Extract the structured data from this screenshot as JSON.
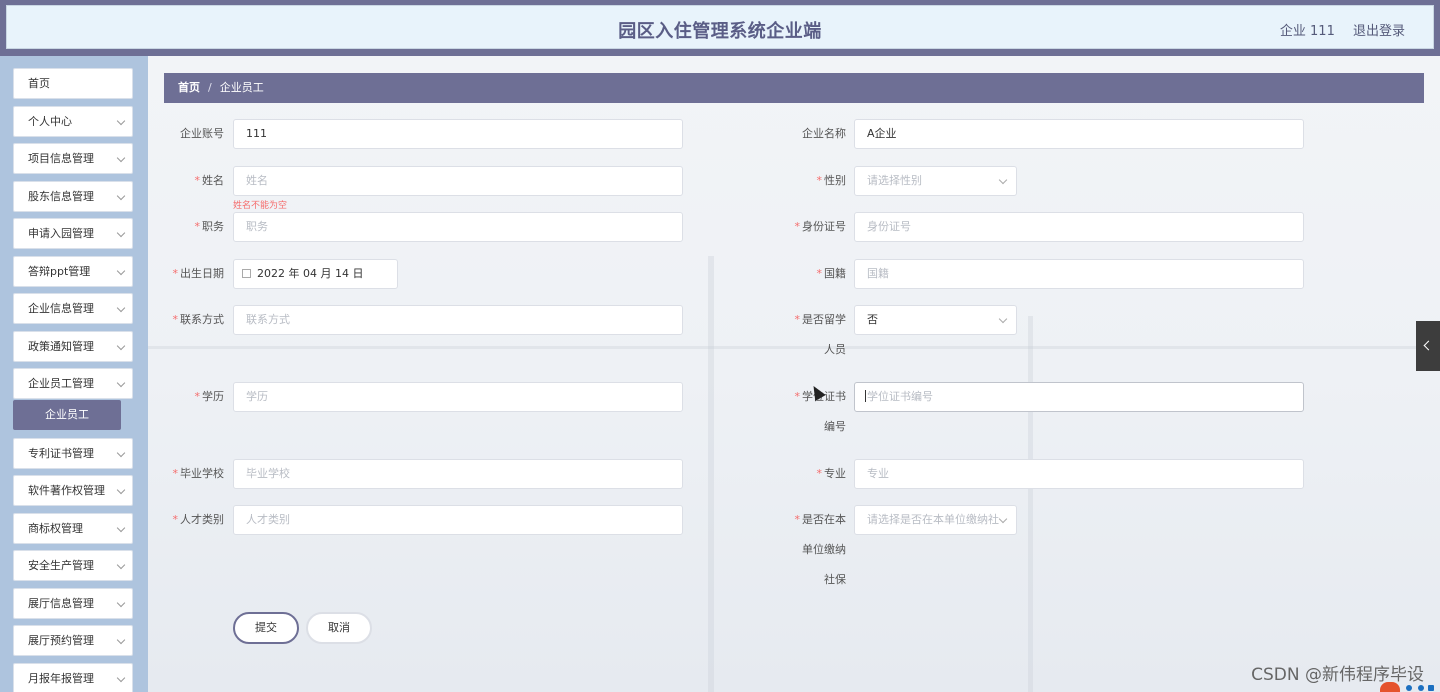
{
  "header": {
    "title": "园区入住管理系统企业端",
    "user": "企业 111",
    "logout": "退出登录"
  },
  "sidebar": {
    "items": [
      {
        "label": "首页",
        "has_arrow": false
      },
      {
        "label": "个人中心",
        "has_arrow": true
      },
      {
        "label": "项目信息管理",
        "has_arrow": true
      },
      {
        "label": "股东信息管理",
        "has_arrow": true
      },
      {
        "label": "申请入园管理",
        "has_arrow": true
      },
      {
        "label": "答辩ppt管理",
        "has_arrow": true
      },
      {
        "label": "企业信息管理",
        "has_arrow": true
      },
      {
        "label": "政策通知管理",
        "has_arrow": true
      },
      {
        "label": "企业员工管理",
        "has_arrow": true
      },
      {
        "label": "专利证书管理",
        "has_arrow": true
      },
      {
        "label": "软件著作权管理",
        "has_arrow": true
      },
      {
        "label": "商标权管理",
        "has_arrow": true
      },
      {
        "label": "安全生产管理",
        "has_arrow": true
      },
      {
        "label": "展厅信息管理",
        "has_arrow": true
      },
      {
        "label": "展厅预约管理",
        "has_arrow": true
      },
      {
        "label": "月报年报管理",
        "has_arrow": true
      }
    ],
    "active_sub": "企业员工"
  },
  "breadcrumb": {
    "home": "首页",
    "separator": "/",
    "current": "企业员工"
  },
  "form": {
    "company_account": {
      "label": "企业账号",
      "value": "111"
    },
    "company_name": {
      "label": "企业名称",
      "value": "A企业"
    },
    "name": {
      "label": "姓名",
      "placeholder": "姓名",
      "error": "姓名不能为空"
    },
    "gender": {
      "label": "性别",
      "placeholder": "请选择性别"
    },
    "position": {
      "label": "职务",
      "placeholder": "职务"
    },
    "id_number": {
      "label": "身份证号",
      "placeholder": "身份证号"
    },
    "birth_date": {
      "label": "出生日期",
      "value": "2022 年 04 月 14 日"
    },
    "nationality": {
      "label": "国籍",
      "placeholder": "国籍"
    },
    "contact": {
      "label": "联系方式",
      "placeholder": "联系方式"
    },
    "studied_abroad": {
      "label_line1": "是否留学",
      "label_line2": "人员",
      "value": "否"
    },
    "education": {
      "label": "学历",
      "placeholder": "学历"
    },
    "degree_cert": {
      "label_line1": "学位证书",
      "label_line2": "编号",
      "placeholder": "学位证书编号"
    },
    "graduate_school": {
      "label": "毕业学校",
      "placeholder": "毕业学校"
    },
    "major": {
      "label": "专业",
      "placeholder": "专业"
    },
    "talent_type": {
      "label": "人才类别",
      "placeholder": "人才类别"
    },
    "social_security": {
      "label_line1": "是否在本",
      "label_line2": "单位缴纳",
      "label_line3": "社保",
      "placeholder": "请选择是否在本单位缴纳社"
    },
    "required_mark": "*"
  },
  "actions": {
    "submit": "提交",
    "cancel": "取消"
  },
  "watermark": "CSDN @新伟程序毕设",
  "colors": {
    "primary": "#6e6f95",
    "sidebar_bg": "#aec4de",
    "header_bg": "#e8f3fb",
    "error": "#f56c6c"
  }
}
